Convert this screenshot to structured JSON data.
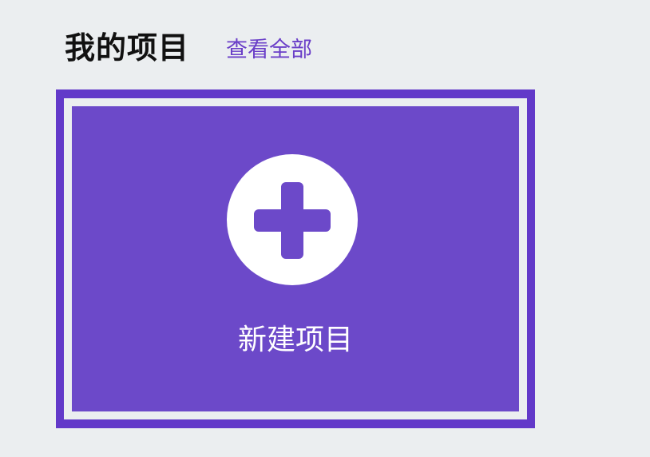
{
  "header": {
    "title": "我的项目",
    "view_all_label": "查看全部"
  },
  "new_project_card": {
    "label": "新建项目",
    "icon": "plus-circle-icon"
  },
  "colors": {
    "accent": "#6c49c9",
    "border": "#6239c9",
    "background": "#ebeef0",
    "link": "#6a3fc8"
  }
}
